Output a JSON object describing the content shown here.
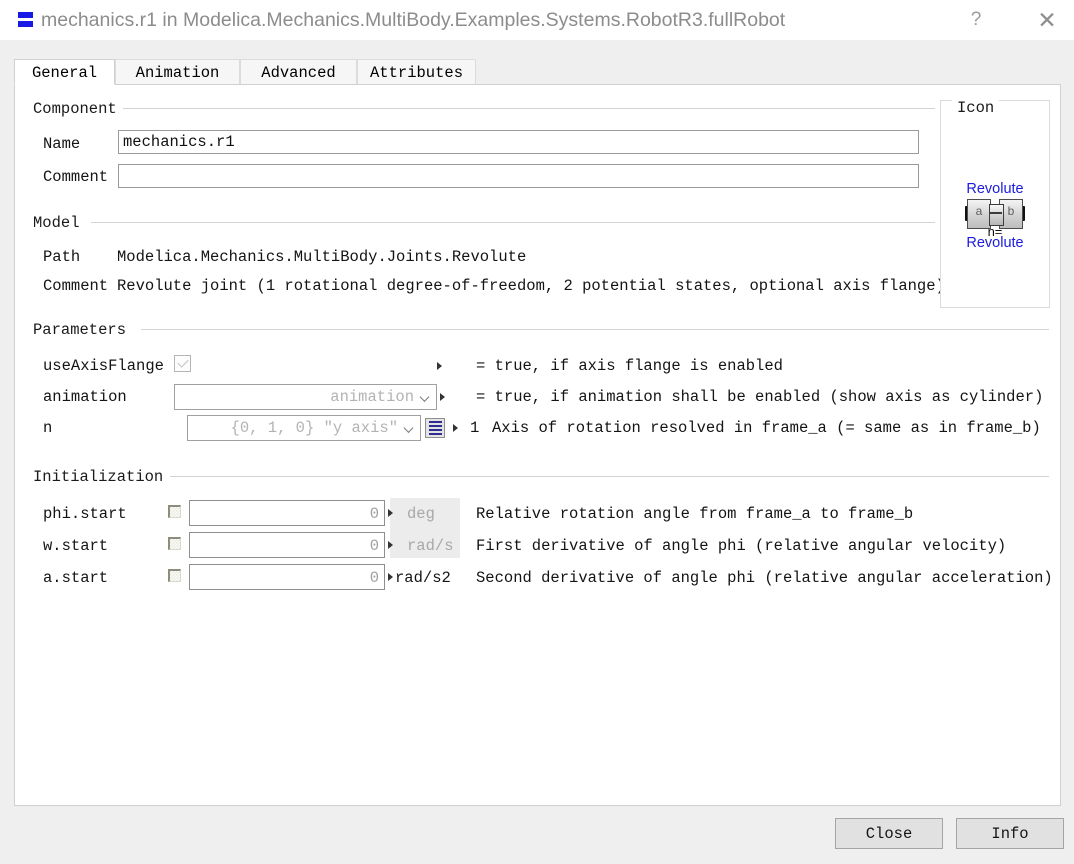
{
  "window": {
    "title": "mechanics.r1 in Modelica.Mechanics.MultiBody.Examples.Systems.RobotR3.fullRobot",
    "app_icon": "modelica-component-icon",
    "help_label": "?",
    "close_label": "✕"
  },
  "tabs": [
    {
      "label": "General",
      "active": true
    },
    {
      "label": "Animation",
      "active": false
    },
    {
      "label": "Advanced",
      "active": false
    },
    {
      "label": "Attributes",
      "active": false
    }
  ],
  "component": {
    "group_label": "Component",
    "name_label": "Name",
    "name_value": "mechanics.r1",
    "comment_label": "Comment",
    "comment_value": ""
  },
  "model": {
    "group_label": "Model",
    "path_label": "Path",
    "path_value": "Modelica.Mechanics.MultiBody.Joints.Revolute",
    "comment_label": "Comment",
    "comment_value": "Revolute joint (1 rotational degree-of-freedom, 2 potential states, optional axis flange)"
  },
  "parameters": {
    "group_label": "Parameters",
    "rows": [
      {
        "name": "useAxisFlange",
        "editor": "checkbox",
        "checked": true,
        "value": "",
        "unit": "",
        "index": "",
        "description": "= true, if axis flange is enabled"
      },
      {
        "name": "animation",
        "editor": "combo",
        "value": "animation",
        "unit": "",
        "index": "",
        "description": "= true, if animation shall be enabled (show axis as cylinder)"
      },
      {
        "name": "n",
        "editor": "combo-with-picker",
        "value": "{0, 1, 0} ″y axis″",
        "picker_icon": "table-list-icon",
        "unit": "",
        "index": "1",
        "description": "Axis of rotation resolved in frame_a (= same as in frame_b)"
      }
    ]
  },
  "initialization": {
    "group_label": "Initialization",
    "rows": [
      {
        "name": "phi.start",
        "checked": false,
        "value": "0",
        "unit": "deg",
        "unit_dimmed": true,
        "description": "Relative rotation angle from frame_a to frame_b"
      },
      {
        "name": "w.start",
        "checked": false,
        "value": "0",
        "unit": "rad/s",
        "unit_dimmed": true,
        "description": "First derivative of angle phi (relative angular velocity)"
      },
      {
        "name": "a.start",
        "checked": false,
        "value": "0",
        "unit": "rad/s2",
        "unit_dimmed": false,
        "description": "Second derivative of angle phi (relative angular acceleration)"
      }
    ]
  },
  "icon_panel": {
    "group_label": "Icon",
    "title_top": "Revolute",
    "title_bottom": "Revolute",
    "axis_label": "n=",
    "frame_a_label": "a",
    "frame_b_label": "b",
    "link_color": "#1b1bdc"
  },
  "footer": {
    "close_label": "Close",
    "info_label": "Info"
  }
}
